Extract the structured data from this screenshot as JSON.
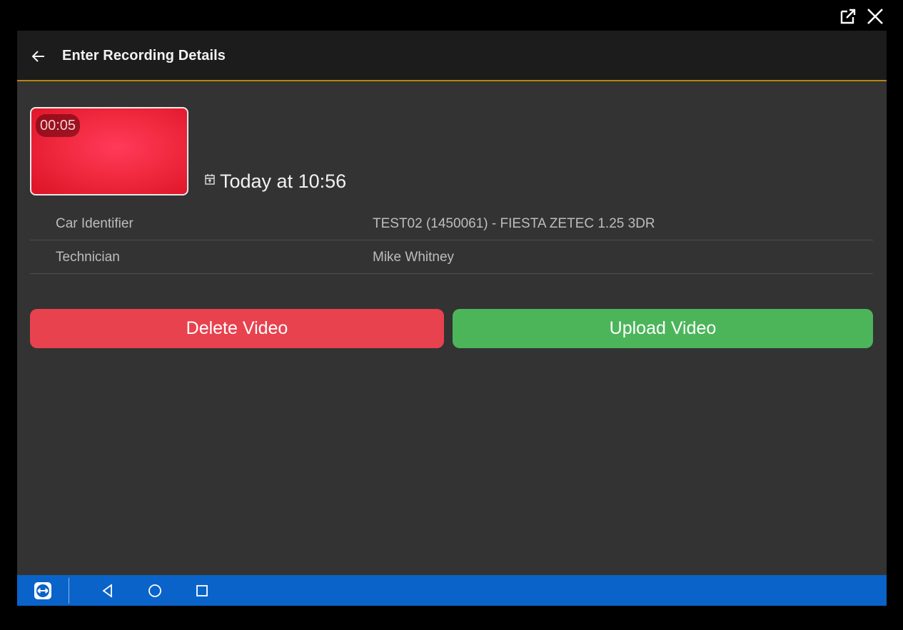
{
  "header": {
    "title": "Enter Recording Details",
    "back_icon": "arrow-left-icon",
    "color_accent": "#b8860b"
  },
  "window_controls": {
    "popout_icon": "external-link-icon",
    "close_icon": "close-icon"
  },
  "recording": {
    "duration": "00:05",
    "date_icon": "calendar-icon",
    "date": "Today at 10:56",
    "thumbnail_color": "#f22a40"
  },
  "details": [
    {
      "label": "Car Identifier",
      "value": "TEST02 (1450061) - FIESTA ZETEC 1.25 3DR"
    },
    {
      "label": "Technician",
      "value": "Mike Whitney"
    }
  ],
  "actions": {
    "delete_label": "Delete Video",
    "delete_color": "#e8424f",
    "upload_label": "Upload Video",
    "upload_color": "#4cb55a"
  },
  "navigation": {
    "app_icon": "teamviewer-icon",
    "back_icon": "triangle-back-icon",
    "home_icon": "circle-home-icon",
    "recents_icon": "square-recents-icon",
    "bar_color": "#0a63c9"
  }
}
